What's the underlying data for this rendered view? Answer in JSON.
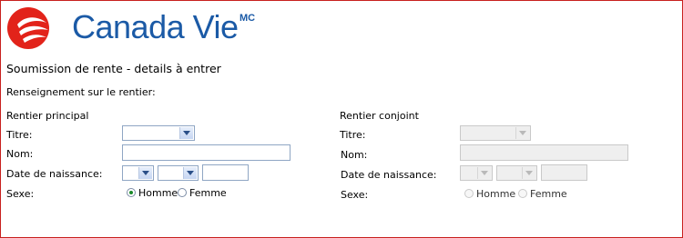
{
  "brand": {
    "name": "Canada Vie",
    "mark": "MC"
  },
  "page": {
    "title": "Soumission de rente - details à entrer",
    "section_title": "Renseignement sur le rentier:"
  },
  "principal": {
    "heading": "Rentier principal",
    "titre_label": "Titre:",
    "nom_label": "Nom:",
    "nom_value": "",
    "dob_label": "Date de naissance:",
    "dob_year_value": "",
    "sexe_label": "Sexe:",
    "homme_label": "Homme",
    "femme_label": "Femme",
    "selected_sexe": "Homme"
  },
  "conjoint": {
    "heading": "Rentier conjoint",
    "titre_label": "Titre:",
    "nom_label": "Nom:",
    "nom_value": "",
    "dob_label": "Date de naissance:",
    "dob_year_value": "",
    "sexe_label": "Sexe:",
    "homme_label": "Homme",
    "femme_label": "Femme",
    "enabled": false
  },
  "colors": {
    "accent": "#1b5aa6",
    "logo": "#e2231a",
    "border": "#c8201e"
  }
}
